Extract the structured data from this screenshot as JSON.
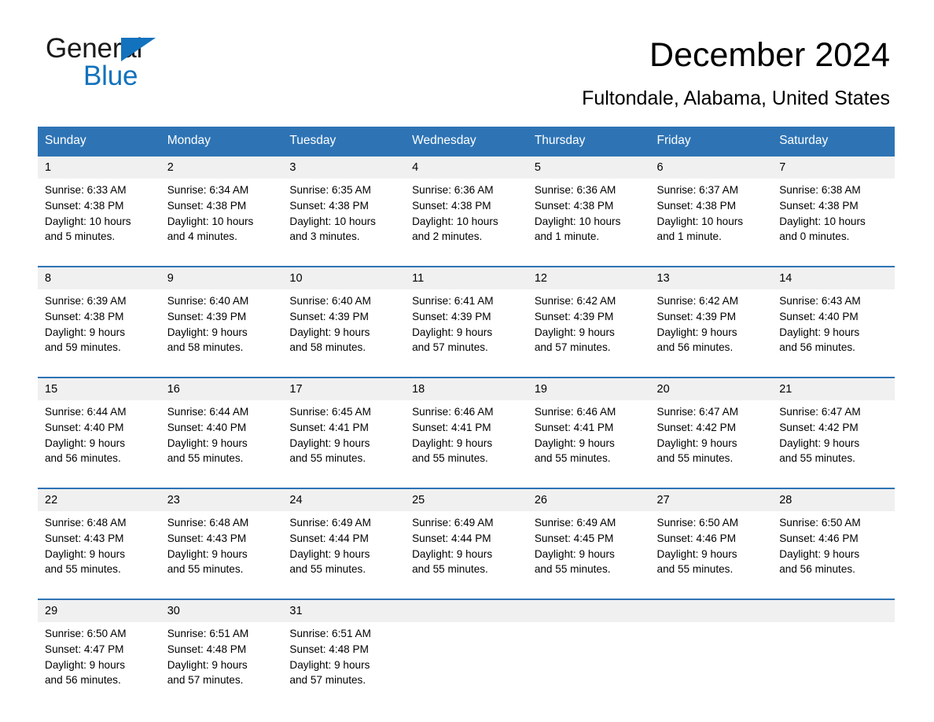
{
  "logo": {
    "word_one": "General",
    "word_two": "Blue",
    "triangle_icon": "blue-triangle-icon",
    "colors": {
      "blue": "#1272bd",
      "black": "#1a1a1a"
    }
  },
  "header": {
    "title": "December 2024",
    "location": "Fultondale, Alabama, United States"
  },
  "theme": {
    "header_blue": "#2e74b5",
    "daynum_band": "#f0f0f0",
    "page_background": "#ffffff",
    "text": "#000000"
  },
  "calendar": {
    "weekday_headers": [
      "Sunday",
      "Monday",
      "Tuesday",
      "Wednesday",
      "Thursday",
      "Friday",
      "Saturday"
    ],
    "weeks": [
      [
        {
          "day": "1",
          "lines": [
            "Sunrise: 6:33 AM",
            "Sunset: 4:38 PM",
            "Daylight: 10 hours",
            "and 5 minutes."
          ]
        },
        {
          "day": "2",
          "lines": [
            "Sunrise: 6:34 AM",
            "Sunset: 4:38 PM",
            "Daylight: 10 hours",
            "and 4 minutes."
          ]
        },
        {
          "day": "3",
          "lines": [
            "Sunrise: 6:35 AM",
            "Sunset: 4:38 PM",
            "Daylight: 10 hours",
            "and 3 minutes."
          ]
        },
        {
          "day": "4",
          "lines": [
            "Sunrise: 6:36 AM",
            "Sunset: 4:38 PM",
            "Daylight: 10 hours",
            "and 2 minutes."
          ]
        },
        {
          "day": "5",
          "lines": [
            "Sunrise: 6:36 AM",
            "Sunset: 4:38 PM",
            "Daylight: 10 hours",
            "and 1 minute."
          ]
        },
        {
          "day": "6",
          "lines": [
            "Sunrise: 6:37 AM",
            "Sunset: 4:38 PM",
            "Daylight: 10 hours",
            "and 1 minute."
          ]
        },
        {
          "day": "7",
          "lines": [
            "Sunrise: 6:38 AM",
            "Sunset: 4:38 PM",
            "Daylight: 10 hours",
            "and 0 minutes."
          ]
        }
      ],
      [
        {
          "day": "8",
          "lines": [
            "Sunrise: 6:39 AM",
            "Sunset: 4:38 PM",
            "Daylight: 9 hours",
            "and 59 minutes."
          ]
        },
        {
          "day": "9",
          "lines": [
            "Sunrise: 6:40 AM",
            "Sunset: 4:39 PM",
            "Daylight: 9 hours",
            "and 58 minutes."
          ]
        },
        {
          "day": "10",
          "lines": [
            "Sunrise: 6:40 AM",
            "Sunset: 4:39 PM",
            "Daylight: 9 hours",
            "and 58 minutes."
          ]
        },
        {
          "day": "11",
          "lines": [
            "Sunrise: 6:41 AM",
            "Sunset: 4:39 PM",
            "Daylight: 9 hours",
            "and 57 minutes."
          ]
        },
        {
          "day": "12",
          "lines": [
            "Sunrise: 6:42 AM",
            "Sunset: 4:39 PM",
            "Daylight: 9 hours",
            "and 57 minutes."
          ]
        },
        {
          "day": "13",
          "lines": [
            "Sunrise: 6:42 AM",
            "Sunset: 4:39 PM",
            "Daylight: 9 hours",
            "and 56 minutes."
          ]
        },
        {
          "day": "14",
          "lines": [
            "Sunrise: 6:43 AM",
            "Sunset: 4:40 PM",
            "Daylight: 9 hours",
            "and 56 minutes."
          ]
        }
      ],
      [
        {
          "day": "15",
          "lines": [
            "Sunrise: 6:44 AM",
            "Sunset: 4:40 PM",
            "Daylight: 9 hours",
            "and 56 minutes."
          ]
        },
        {
          "day": "16",
          "lines": [
            "Sunrise: 6:44 AM",
            "Sunset: 4:40 PM",
            "Daylight: 9 hours",
            "and 55 minutes."
          ]
        },
        {
          "day": "17",
          "lines": [
            "Sunrise: 6:45 AM",
            "Sunset: 4:41 PM",
            "Daylight: 9 hours",
            "and 55 minutes."
          ]
        },
        {
          "day": "18",
          "lines": [
            "Sunrise: 6:46 AM",
            "Sunset: 4:41 PM",
            "Daylight: 9 hours",
            "and 55 minutes."
          ]
        },
        {
          "day": "19",
          "lines": [
            "Sunrise: 6:46 AM",
            "Sunset: 4:41 PM",
            "Daylight: 9 hours",
            "and 55 minutes."
          ]
        },
        {
          "day": "20",
          "lines": [
            "Sunrise: 6:47 AM",
            "Sunset: 4:42 PM",
            "Daylight: 9 hours",
            "and 55 minutes."
          ]
        },
        {
          "day": "21",
          "lines": [
            "Sunrise: 6:47 AM",
            "Sunset: 4:42 PM",
            "Daylight: 9 hours",
            "and 55 minutes."
          ]
        }
      ],
      [
        {
          "day": "22",
          "lines": [
            "Sunrise: 6:48 AM",
            "Sunset: 4:43 PM",
            "Daylight: 9 hours",
            "and 55 minutes."
          ]
        },
        {
          "day": "23",
          "lines": [
            "Sunrise: 6:48 AM",
            "Sunset: 4:43 PM",
            "Daylight: 9 hours",
            "and 55 minutes."
          ]
        },
        {
          "day": "24",
          "lines": [
            "Sunrise: 6:49 AM",
            "Sunset: 4:44 PM",
            "Daylight: 9 hours",
            "and 55 minutes."
          ]
        },
        {
          "day": "25",
          "lines": [
            "Sunrise: 6:49 AM",
            "Sunset: 4:44 PM",
            "Daylight: 9 hours",
            "and 55 minutes."
          ]
        },
        {
          "day": "26",
          "lines": [
            "Sunrise: 6:49 AM",
            "Sunset: 4:45 PM",
            "Daylight: 9 hours",
            "and 55 minutes."
          ]
        },
        {
          "day": "27",
          "lines": [
            "Sunrise: 6:50 AM",
            "Sunset: 4:46 PM",
            "Daylight: 9 hours",
            "and 55 minutes."
          ]
        },
        {
          "day": "28",
          "lines": [
            "Sunrise: 6:50 AM",
            "Sunset: 4:46 PM",
            "Daylight: 9 hours",
            "and 56 minutes."
          ]
        }
      ],
      [
        {
          "day": "29",
          "lines": [
            "Sunrise: 6:50 AM",
            "Sunset: 4:47 PM",
            "Daylight: 9 hours",
            "and 56 minutes."
          ]
        },
        {
          "day": "30",
          "lines": [
            "Sunrise: 6:51 AM",
            "Sunset: 4:48 PM",
            "Daylight: 9 hours",
            "and 57 minutes."
          ]
        },
        {
          "day": "31",
          "lines": [
            "Sunrise: 6:51 AM",
            "Sunset: 4:48 PM",
            "Daylight: 9 hours",
            "and 57 minutes."
          ]
        },
        {
          "day": "",
          "lines": []
        },
        {
          "day": "",
          "lines": []
        },
        {
          "day": "",
          "lines": []
        },
        {
          "day": "",
          "lines": []
        }
      ]
    ]
  }
}
